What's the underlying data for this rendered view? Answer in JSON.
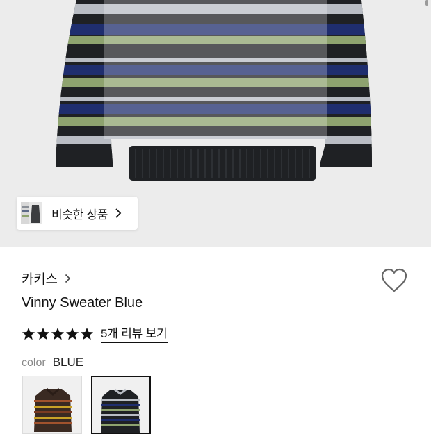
{
  "hero": {
    "similar_label": "비슷한 상품",
    "colors": {
      "background": "#ececec",
      "navy": "#1f2e6e",
      "green": "#8ea36f",
      "grey": "#b9bdc4",
      "black": "#1f2124"
    }
  },
  "product": {
    "brand": "카키스",
    "name": "Vinny Sweater Blue",
    "rating_stars": 5,
    "review_link": "5개 리뷰 보기",
    "color_label": "color",
    "color_value": "BLUE",
    "swatches": [
      {
        "color": "BROWN",
        "selected": false
      },
      {
        "color": "BLUE",
        "selected": true
      }
    ]
  },
  "icons": {
    "brand_chevron": "chevron-right-icon",
    "chip_chevron": "chevron-right-icon",
    "wishlist": "heart-icon",
    "star": "star-icon"
  }
}
